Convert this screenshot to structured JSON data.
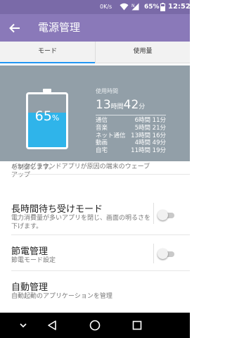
{
  "status_bar": {
    "network_speed": "0K/s",
    "battery_percent": "65%",
    "clock": "12:52",
    "icons": [
      "wifi-icon",
      "signal-icon",
      "battery-icon"
    ]
  },
  "app_bar": {
    "title": "電源管理",
    "back_icon": "back-arrow-icon"
  },
  "tabs": [
    {
      "label": "モード",
      "selected": true
    },
    {
      "label": "使用量",
      "selected": false
    }
  ],
  "list": {
    "partial_sub_line1": "バックグラウンドアプリが原因の端末のウェーブアップ",
    "partial_sub_line2": "を制御します。",
    "items": [
      {
        "title": "長時間待ち受けモード",
        "subtitle": "電力消費量が多いアプリを閉じ、画面の明るさを下げます。",
        "toggle": false
      },
      {
        "title": "節電管理",
        "subtitle": "節電モード設定",
        "toggle": false
      },
      {
        "title": "自動管理",
        "subtitle": "自動起動のアプリケーションを管理"
      }
    ]
  },
  "battery_overlay": {
    "percent_value": "65",
    "percent_unit": "%",
    "level": 0.65,
    "usage_label": "使用時間",
    "total_hours": "13",
    "hours_unit": "時間",
    "total_minutes": "42",
    "minutes_unit": "分",
    "rows": [
      {
        "label": "通信",
        "value": "6時間 11分"
      },
      {
        "label": "音楽",
        "value": "5時間 21分"
      },
      {
        "label": "ネット通信",
        "value": "13時間 16分"
      },
      {
        "label": "動画",
        "value": "4時間 49分"
      },
      {
        "label": "自宅",
        "value": "11時間 19分"
      }
    ],
    "colors": {
      "background": "#929fa8",
      "fill": "#2fb4ea"
    }
  },
  "nav_bar": {
    "buttons": [
      "chevron-down-icon",
      "back-triangle-icon",
      "home-circle-icon",
      "recents-square-icon"
    ]
  },
  "colors": {
    "status_bar": "#7a6aa8",
    "app_bar": "#8a79b9",
    "tab_indicator": "#2196f3"
  }
}
